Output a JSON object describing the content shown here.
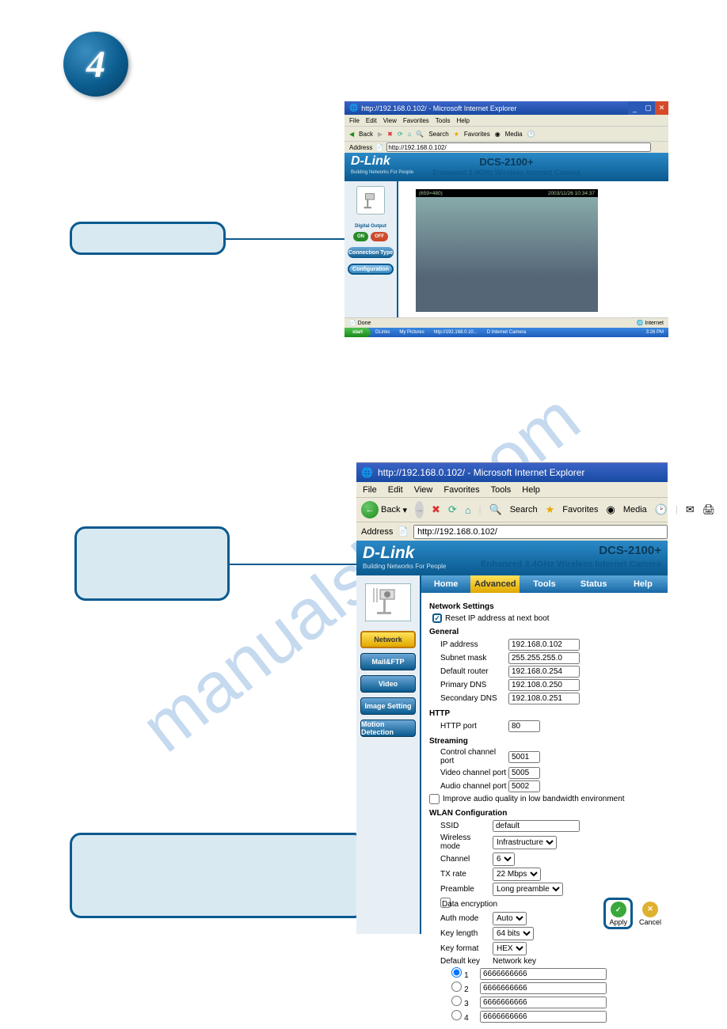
{
  "step_num": "4",
  "watermark": "manualslive.com",
  "shot1": {
    "title": "http://192.168.0.102/ - Microsoft Internet Explorer",
    "menu": [
      "File",
      "Edit",
      "View",
      "Favorites",
      "Tools",
      "Help"
    ],
    "tb_back": "Back",
    "tb_search": "Search",
    "tb_fav": "Favorites",
    "tb_media": "Media",
    "addr_label": "Address",
    "addr_value": "http://192.168.0.102/",
    "dlink": "D-Link",
    "dlink_sub": "Building Networks For People",
    "hdr_title": "DCS-2100+",
    "hdr_sub": "Enhanced 2.4GHz Wireless Internet Camera",
    "side_out": "Digital Output",
    "on": "ON",
    "off": "OFF",
    "side_b1": "Connection Type",
    "side_b2": "Configuration",
    "vid_left": "(659×480)",
    "vid_right": "2003/11/26 10:34:37",
    "status": "Done",
    "status_r": "Internet",
    "start": "start",
    "tb_items": [
      "",
      "DLinks",
      "My Pictures",
      "http://192.168.0.10...",
      "D Internet Camera"
    ],
    "clock": "3:26 PM"
  },
  "shot2": {
    "title": "http://192.168.0.102/ - Microsoft Internet Explorer",
    "menu": [
      "File",
      "Edit",
      "View",
      "Favorites",
      "Tools",
      "Help"
    ],
    "tb_back": "Back",
    "tb_search": "Search",
    "tb_fav": "Favorites",
    "tb_media": "Media",
    "addr_label": "Address",
    "addr_value": "http://192.168.0.102/",
    "dlink": "D-Link",
    "dlink_sub": "Building Networks For People",
    "hdr_title": "DCS-2100+",
    "hdr_sub": "Enhanced 2.4GHz Wireless Internet Camera",
    "tabs": [
      "Home",
      "Advanced",
      "Tools",
      "Status",
      "Help"
    ],
    "side": [
      "Network",
      "Mail&FTP",
      "Video",
      "Image Setting",
      "Motion Detection"
    ],
    "net_settings": "Network Settings",
    "reset_ip": "Reset IP address at next boot",
    "general": "General",
    "ip_l": "IP address",
    "ip_v": "192.168.0.102",
    "sm_l": "Subnet mask",
    "sm_v": "255.255.255.0",
    "dr_l": "Default router",
    "dr_v": "192.168.0.254",
    "pdns_l": "Primary DNS",
    "pdns_v": "192.108.0.250",
    "sdns_l": "Secondary DNS",
    "sdns_v": "192.108.0.251",
    "http": "HTTP",
    "hp_l": "HTTP port",
    "hp_v": "80",
    "stream": "Streaming",
    "ccp_l": "Control channel port",
    "ccp_v": "5001",
    "vcp_l": "Video channel port",
    "vcp_v": "5005",
    "acp_l": "Audio channel port",
    "acp_v": "5002",
    "improve": "Improve audio quality in low bandwidth environment",
    "wlan": "WLAN Configuration",
    "ssid_l": "SSID",
    "ssid_v": "default",
    "wm_l": "Wireless mode",
    "wm_v": "Infrastructure",
    "ch_l": "Channel",
    "ch_v": "6",
    "tx_l": "TX rate",
    "tx_v": "22 Mbps",
    "pre_l": "Preamble",
    "pre_v": "Long preamble",
    "de_l": "Data encryption",
    "am_l": "Auth mode",
    "am_v": "Auto",
    "kl_l": "Key length",
    "kl_v": "64 bits",
    "kf_l": "Key format",
    "kf_v": "HEX",
    "dk_l": "Default key",
    "nk_l": "Network key",
    "k1": "1",
    "k2": "2",
    "k3": "3",
    "k4": "4",
    "kv": "6666666666",
    "apply": "Apply",
    "cancel": "Cancel"
  }
}
